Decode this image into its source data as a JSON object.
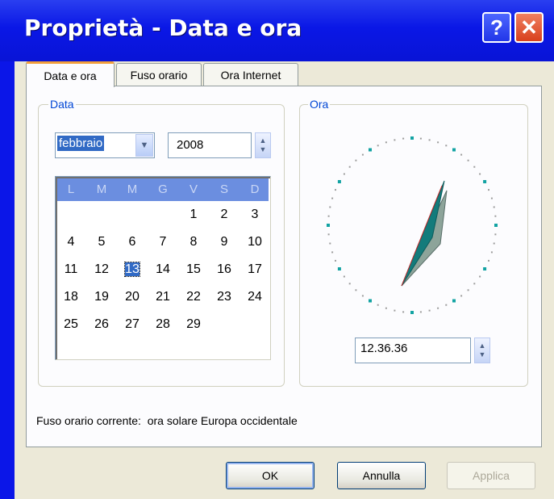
{
  "window": {
    "title": "Proprietà - Data e ora",
    "help_label": "?",
    "close_label": "✕"
  },
  "tabs": [
    {
      "label": "Data e ora",
      "active": true
    },
    {
      "label": "Fuso orario",
      "active": false
    },
    {
      "label": "Ora Internet",
      "active": false
    }
  ],
  "date_group": {
    "legend": "Data",
    "month": "febbraio",
    "year": "2008",
    "weekday_headers": [
      "L",
      "M",
      "M",
      "G",
      "V",
      "S",
      "D"
    ],
    "selected_day": 13,
    "weeks": [
      [
        "",
        "",
        "",
        "",
        "1",
        "2",
        "3"
      ],
      [
        "4",
        "5",
        "6",
        "7",
        "8",
        "9",
        "10"
      ],
      [
        "11",
        "12",
        "13",
        "14",
        "15",
        "16",
        "17"
      ],
      [
        "18",
        "19",
        "20",
        "21",
        "22",
        "23",
        "24"
      ],
      [
        "25",
        "26",
        "27",
        "28",
        "29",
        "",
        ""
      ]
    ]
  },
  "time_group": {
    "legend": "Ora",
    "time": "12.36.36"
  },
  "timezone_text": "Fuso orario corrente:  ora solare Europa occidentale",
  "buttons": {
    "ok": "OK",
    "cancel": "Annulla",
    "apply": "Applica"
  },
  "colors": {
    "titlebar": "#0a17e6",
    "dialog": "#ece9d8",
    "selection": "#316ac5",
    "legend": "#0046d5"
  }
}
